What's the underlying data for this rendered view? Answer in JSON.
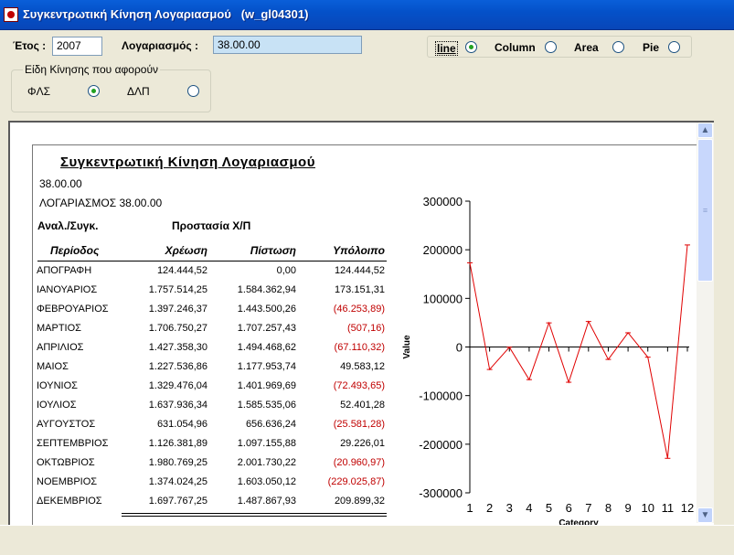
{
  "window": {
    "title": "Συγκεντρωτική Κίνηση Λογαριασμού   (w_gl04301)"
  },
  "form": {
    "year_label": "Έτος :",
    "year_value": "2007",
    "account_label": "Λογαριασμός :",
    "account_value": "38.00.00",
    "group_title": "Είδη Κίνησης που αφορούν",
    "option1": "ΦΛΣ",
    "option2": "ΔΛΠ",
    "selected_option": "ΦΛΣ"
  },
  "chart_type": {
    "options": [
      "line",
      "Column",
      "Area",
      "Pie"
    ],
    "selected": "line"
  },
  "report": {
    "title": "Συγκεντρωτική Κίνηση Λογαριασμού",
    "account_code": "38.00.00",
    "account_line": "ΛΟΓΑΡΙΑΣΜΟΣ 38.00.00",
    "anal_label": "Αναλ./Συγκ.",
    "anal_value": "Προστασία Χ/Π",
    "columns": [
      "Περίοδος",
      "Χρέωση",
      "Πίστωση",
      "Υπόλοιπο"
    ],
    "rows": [
      {
        "period": "ΑΠΟΓΡΑΦΗ",
        "debit": "124.444,52",
        "credit": "0,00",
        "balance": "124.444,52",
        "negative": false
      },
      {
        "period": "ΙΑΝΟΥΑΡΙΟΣ",
        "debit": "1.757.514,25",
        "credit": "1.584.362,94",
        "balance": "173.151,31",
        "negative": false
      },
      {
        "period": "ΦΕΒΡΟΥΑΡΙΟΣ",
        "debit": "1.397.246,37",
        "credit": "1.443.500,26",
        "balance": "(46.253,89)",
        "negative": true
      },
      {
        "period": "ΜΑΡΤΙΟΣ",
        "debit": "1.706.750,27",
        "credit": "1.707.257,43",
        "balance": "(507,16)",
        "negative": true
      },
      {
        "period": "ΑΠΡΙΛΙΟΣ",
        "debit": "1.427.358,30",
        "credit": "1.494.468,62",
        "balance": "(67.110,32)",
        "negative": true
      },
      {
        "period": "ΜΑΙΟΣ",
        "debit": "1.227.536,86",
        "credit": "1.177.953,74",
        "balance": "49.583,12",
        "negative": false
      },
      {
        "period": "ΙΟΥΝΙΟΣ",
        "debit": "1.329.476,04",
        "credit": "1.401.969,69",
        "balance": "(72.493,65)",
        "negative": true
      },
      {
        "period": "ΙΟΥΛΙΟΣ",
        "debit": "1.637.936,34",
        "credit": "1.585.535,06",
        "balance": "52.401,28",
        "negative": false
      },
      {
        "period": "ΑΥΓΟΥΣΤΟΣ",
        "debit": "631.054,96",
        "credit": "656.636,24",
        "balance": "(25.581,28)",
        "negative": true
      },
      {
        "period": "ΣΕΠΤΕΜΒΡΙΟΣ",
        "debit": "1.126.381,89",
        "credit": "1.097.155,88",
        "balance": "29.226,01",
        "negative": false
      },
      {
        "period": "ΟΚΤΩΒΡΙΟΣ",
        "debit": "1.980.769,25",
        "credit": "2.001.730,22",
        "balance": "(20.960,97)",
        "negative": true
      },
      {
        "period": "ΝΟΕΜΒΡΙΟΣ",
        "debit": "1.374.024,25",
        "credit": "1.603.050,12",
        "balance": "(229.025,87)",
        "negative": true
      },
      {
        "period": "ΔΕΚΕΜΒΡΙΟΣ",
        "debit": "1.697.767,25",
        "credit": "1.487.867,93",
        "balance": "209.899,32",
        "negative": false
      }
    ],
    "negative_color": "#C00000"
  },
  "chart_data": {
    "type": "line",
    "x": [
      1,
      2,
      3,
      4,
      5,
      6,
      7,
      8,
      9,
      10,
      11,
      12
    ],
    "series": [
      {
        "values": [
          173151.31,
          -46253.89,
          -507.16,
          -67110.32,
          49583.12,
          -72493.65,
          52401.28,
          -25581.28,
          29226.01,
          -20960.97,
          -229025.87,
          209899.32
        ],
        "color": "#E00000"
      }
    ],
    "xlabel": "Category",
    "ylabel": "Value",
    "ylim": [
      -300000,
      300000
    ],
    "yticks": [
      "300000",
      "200000",
      "100000",
      "0",
      "-100000",
      "-200000",
      "-300000"
    ],
    "xticks": [
      "1",
      "2",
      "3",
      "4",
      "5",
      "6",
      "7",
      "8",
      "9",
      "10",
      "11",
      "12"
    ]
  },
  "colors": {
    "titlebar": "#0A5FD9",
    "window_bg": "#ECE9D8",
    "account_field_bg": "#C8E2F5"
  }
}
